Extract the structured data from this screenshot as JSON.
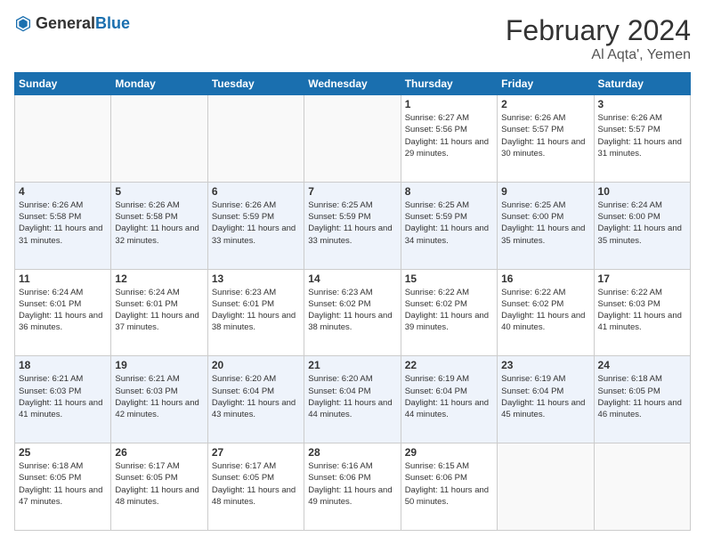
{
  "header": {
    "logo_general": "General",
    "logo_blue": "Blue",
    "month_year": "February 2024",
    "location": "Al Aqta', Yemen"
  },
  "days_of_week": [
    "Sunday",
    "Monday",
    "Tuesday",
    "Wednesday",
    "Thursday",
    "Friday",
    "Saturday"
  ],
  "weeks": [
    [
      {
        "day": "",
        "info": ""
      },
      {
        "day": "",
        "info": ""
      },
      {
        "day": "",
        "info": ""
      },
      {
        "day": "",
        "info": ""
      },
      {
        "day": "1",
        "info": "Sunrise: 6:27 AM\nSunset: 5:56 PM\nDaylight: 11 hours and 29 minutes."
      },
      {
        "day": "2",
        "info": "Sunrise: 6:26 AM\nSunset: 5:57 PM\nDaylight: 11 hours and 30 minutes."
      },
      {
        "day": "3",
        "info": "Sunrise: 6:26 AM\nSunset: 5:57 PM\nDaylight: 11 hours and 31 minutes."
      }
    ],
    [
      {
        "day": "4",
        "info": "Sunrise: 6:26 AM\nSunset: 5:58 PM\nDaylight: 11 hours and 31 minutes."
      },
      {
        "day": "5",
        "info": "Sunrise: 6:26 AM\nSunset: 5:58 PM\nDaylight: 11 hours and 32 minutes."
      },
      {
        "day": "6",
        "info": "Sunrise: 6:26 AM\nSunset: 5:59 PM\nDaylight: 11 hours and 33 minutes."
      },
      {
        "day": "7",
        "info": "Sunrise: 6:25 AM\nSunset: 5:59 PM\nDaylight: 11 hours and 33 minutes."
      },
      {
        "day": "8",
        "info": "Sunrise: 6:25 AM\nSunset: 5:59 PM\nDaylight: 11 hours and 34 minutes."
      },
      {
        "day": "9",
        "info": "Sunrise: 6:25 AM\nSunset: 6:00 PM\nDaylight: 11 hours and 35 minutes."
      },
      {
        "day": "10",
        "info": "Sunrise: 6:24 AM\nSunset: 6:00 PM\nDaylight: 11 hours and 35 minutes."
      }
    ],
    [
      {
        "day": "11",
        "info": "Sunrise: 6:24 AM\nSunset: 6:01 PM\nDaylight: 11 hours and 36 minutes."
      },
      {
        "day": "12",
        "info": "Sunrise: 6:24 AM\nSunset: 6:01 PM\nDaylight: 11 hours and 37 minutes."
      },
      {
        "day": "13",
        "info": "Sunrise: 6:23 AM\nSunset: 6:01 PM\nDaylight: 11 hours and 38 minutes."
      },
      {
        "day": "14",
        "info": "Sunrise: 6:23 AM\nSunset: 6:02 PM\nDaylight: 11 hours and 38 minutes."
      },
      {
        "day": "15",
        "info": "Sunrise: 6:22 AM\nSunset: 6:02 PM\nDaylight: 11 hours and 39 minutes."
      },
      {
        "day": "16",
        "info": "Sunrise: 6:22 AM\nSunset: 6:02 PM\nDaylight: 11 hours and 40 minutes."
      },
      {
        "day": "17",
        "info": "Sunrise: 6:22 AM\nSunset: 6:03 PM\nDaylight: 11 hours and 41 minutes."
      }
    ],
    [
      {
        "day": "18",
        "info": "Sunrise: 6:21 AM\nSunset: 6:03 PM\nDaylight: 11 hours and 41 minutes."
      },
      {
        "day": "19",
        "info": "Sunrise: 6:21 AM\nSunset: 6:03 PM\nDaylight: 11 hours and 42 minutes."
      },
      {
        "day": "20",
        "info": "Sunrise: 6:20 AM\nSunset: 6:04 PM\nDaylight: 11 hours and 43 minutes."
      },
      {
        "day": "21",
        "info": "Sunrise: 6:20 AM\nSunset: 6:04 PM\nDaylight: 11 hours and 44 minutes."
      },
      {
        "day": "22",
        "info": "Sunrise: 6:19 AM\nSunset: 6:04 PM\nDaylight: 11 hours and 44 minutes."
      },
      {
        "day": "23",
        "info": "Sunrise: 6:19 AM\nSunset: 6:04 PM\nDaylight: 11 hours and 45 minutes."
      },
      {
        "day": "24",
        "info": "Sunrise: 6:18 AM\nSunset: 6:05 PM\nDaylight: 11 hours and 46 minutes."
      }
    ],
    [
      {
        "day": "25",
        "info": "Sunrise: 6:18 AM\nSunset: 6:05 PM\nDaylight: 11 hours and 47 minutes."
      },
      {
        "day": "26",
        "info": "Sunrise: 6:17 AM\nSunset: 6:05 PM\nDaylight: 11 hours and 48 minutes."
      },
      {
        "day": "27",
        "info": "Sunrise: 6:17 AM\nSunset: 6:05 PM\nDaylight: 11 hours and 48 minutes."
      },
      {
        "day": "28",
        "info": "Sunrise: 6:16 AM\nSunset: 6:06 PM\nDaylight: 11 hours and 49 minutes."
      },
      {
        "day": "29",
        "info": "Sunrise: 6:15 AM\nSunset: 6:06 PM\nDaylight: 11 hours and 50 minutes."
      },
      {
        "day": "",
        "info": ""
      },
      {
        "day": "",
        "info": ""
      }
    ]
  ]
}
